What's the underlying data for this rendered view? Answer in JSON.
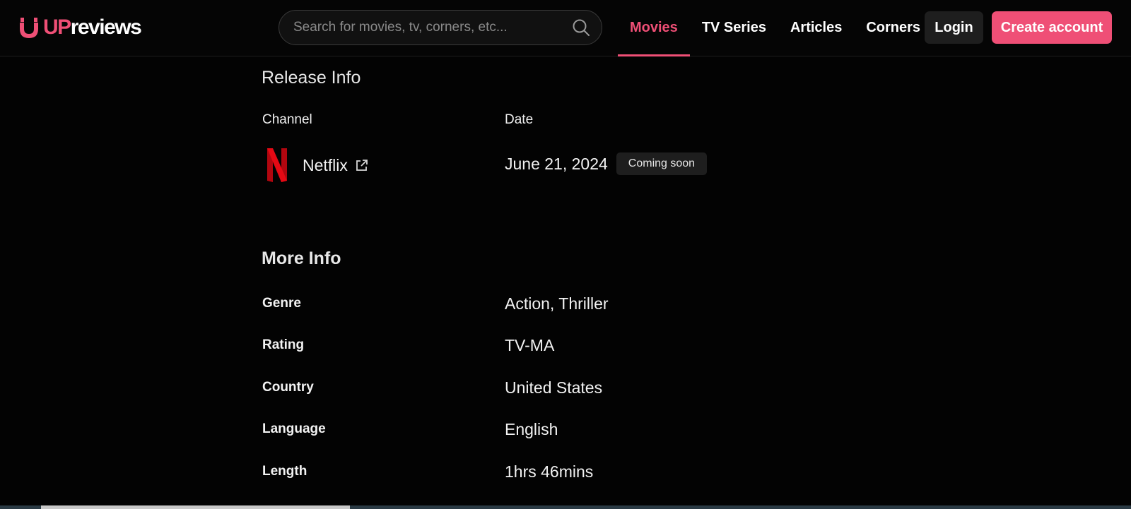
{
  "header": {
    "logo": {
      "up": "UP",
      "rest": "reviews"
    },
    "search": {
      "placeholder": "Search for movies, tv, corners, etc..."
    },
    "nav": [
      {
        "label": "Movies",
        "active": true
      },
      {
        "label": "TV Series",
        "active": false
      },
      {
        "label": "Articles",
        "active": false
      },
      {
        "label": "Corners",
        "active": false
      }
    ],
    "login_label": "Login",
    "create_label": "Create account"
  },
  "release": {
    "title": "Release Info",
    "channel_head": "Channel",
    "date_head": "Date",
    "channel_name": "Netflix",
    "date": "June 21, 2024",
    "badge": "Coming soon"
  },
  "more": {
    "title": "More Info",
    "rows": [
      {
        "label": "Genre",
        "value": "Action, Thriller"
      },
      {
        "label": "Rating",
        "value": "TV-MA"
      },
      {
        "label": "Country",
        "value": "United States"
      },
      {
        "label": "Language",
        "value": "English"
      },
      {
        "label": "Length",
        "value": "1hrs 46mins"
      }
    ]
  },
  "colors": {
    "accent": "#ef4f76",
    "background": "#030303",
    "netflix": "#e50914"
  },
  "icons": [
    "logo-icon",
    "search-icon",
    "netflix-icon",
    "external-link-icon"
  ]
}
